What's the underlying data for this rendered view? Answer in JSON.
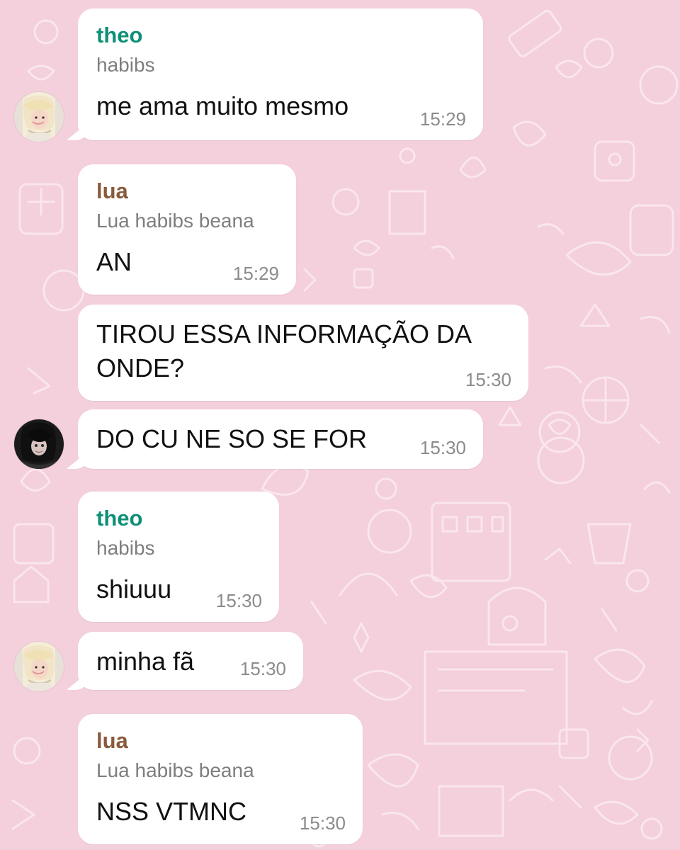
{
  "messages": [
    {
      "sender": "theo",
      "subtitle": "habibs",
      "text": "me ama muito mesmo",
      "time": "15:29"
    },
    {
      "sender": "lua",
      "subtitle": "Lua habibs beana",
      "text": "AN",
      "time": "15:29"
    },
    {
      "text_line1": "TIROU ESSA INFORMAÇÃO DA",
      "text_line2": "ONDE?",
      "time": "15:30"
    },
    {
      "text": "DO CU NE SO SE FOR",
      "time": "15:30"
    },
    {
      "sender": "theo",
      "subtitle": "habibs",
      "text": "shiuuu",
      "time": "15:30"
    },
    {
      "text": "minha fã",
      "time": "15:30"
    },
    {
      "sender": "lua",
      "subtitle": "Lua habibs beana",
      "text": "NSS VTMNC",
      "time": "15:30"
    }
  ],
  "colors": {
    "background": "#f4cfdc",
    "bubble": "#ffffff",
    "theo_name": "#0f8f78",
    "lua_name": "#8a5a3b",
    "timestamp": "#8b8b8b"
  }
}
